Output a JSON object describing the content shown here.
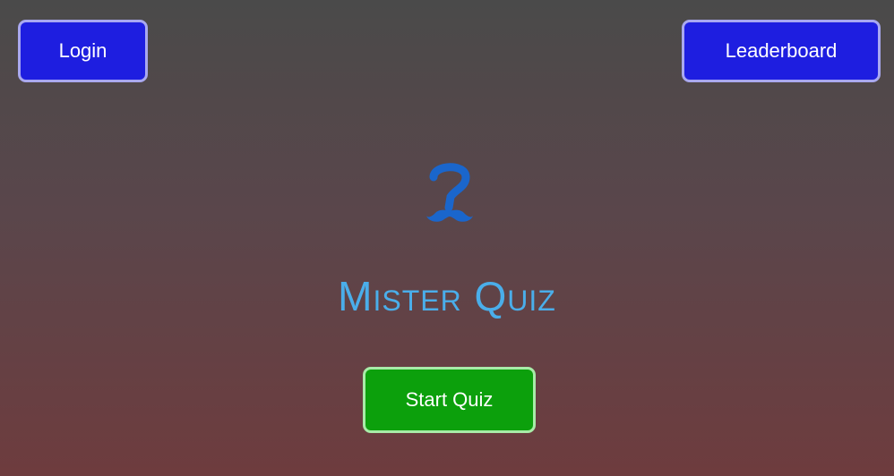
{
  "header": {
    "login_label": "Login",
    "leaderboard_label": "Leaderboard"
  },
  "main": {
    "logo_icon": "question-mustache-icon",
    "title": "Mister Quiz",
    "start_label": "Start Quiz"
  },
  "colors": {
    "nav_button_bg": "#1e1ee0",
    "nav_button_border": "#a9a8f0",
    "start_button_bg": "#0ca00c",
    "start_button_border": "#a8eca8",
    "title_color": "#4aaeea",
    "logo_color": "#1a66cc"
  }
}
